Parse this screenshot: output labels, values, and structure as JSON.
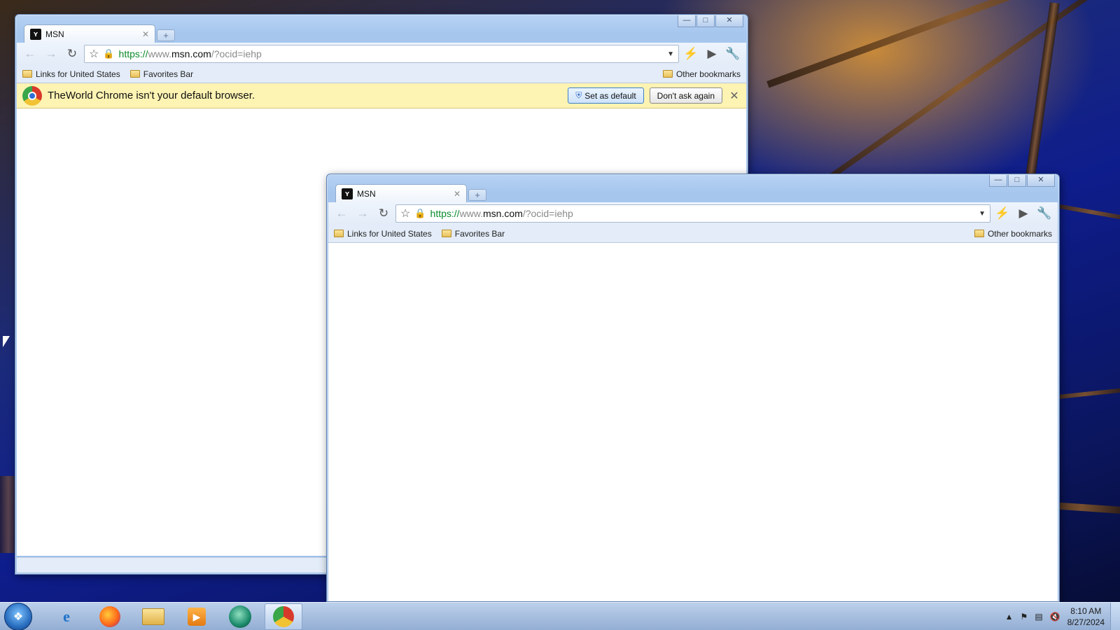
{
  "colors": {
    "infobar_bg": "#fdf3b3",
    "url_scheme": "#0a8a2a",
    "taskbar": "#93aed4"
  },
  "windows": [
    {
      "id": "back",
      "tab": {
        "title": "MSN",
        "favicon": "msn-butterfly-icon"
      },
      "url": {
        "scheme": "https://",
        "www": "www.",
        "domain": "msn.com",
        "path": "/?ocid=iehp"
      },
      "bookmarks": [
        "Links for United States",
        "Favorites Bar"
      ],
      "other_bookmarks": "Other bookmarks",
      "infobar": {
        "message": "TheWorld Chrome isn't your default browser.",
        "set_default": "Set as default",
        "dont_ask": "Don't ask again"
      }
    },
    {
      "id": "front",
      "tab": {
        "title": "MSN",
        "favicon": "msn-butterfly-icon"
      },
      "url": {
        "scheme": "https://",
        "www": "www.",
        "domain": "msn.com",
        "path": "/?ocid=iehp"
      },
      "bookmarks": [
        "Links for United States",
        "Favorites Bar"
      ],
      "other_bookmarks": "Other bookmarks"
    }
  ],
  "taskbar": {
    "items": [
      "internet-explorer-icon",
      "firefox-icon",
      "windows-explorer-icon",
      "media-player-icon",
      "theworld-browser-icon",
      "theworld-chrome-icon"
    ],
    "clock": {
      "time": "8:10 AM",
      "date": "8/27/2024"
    }
  }
}
